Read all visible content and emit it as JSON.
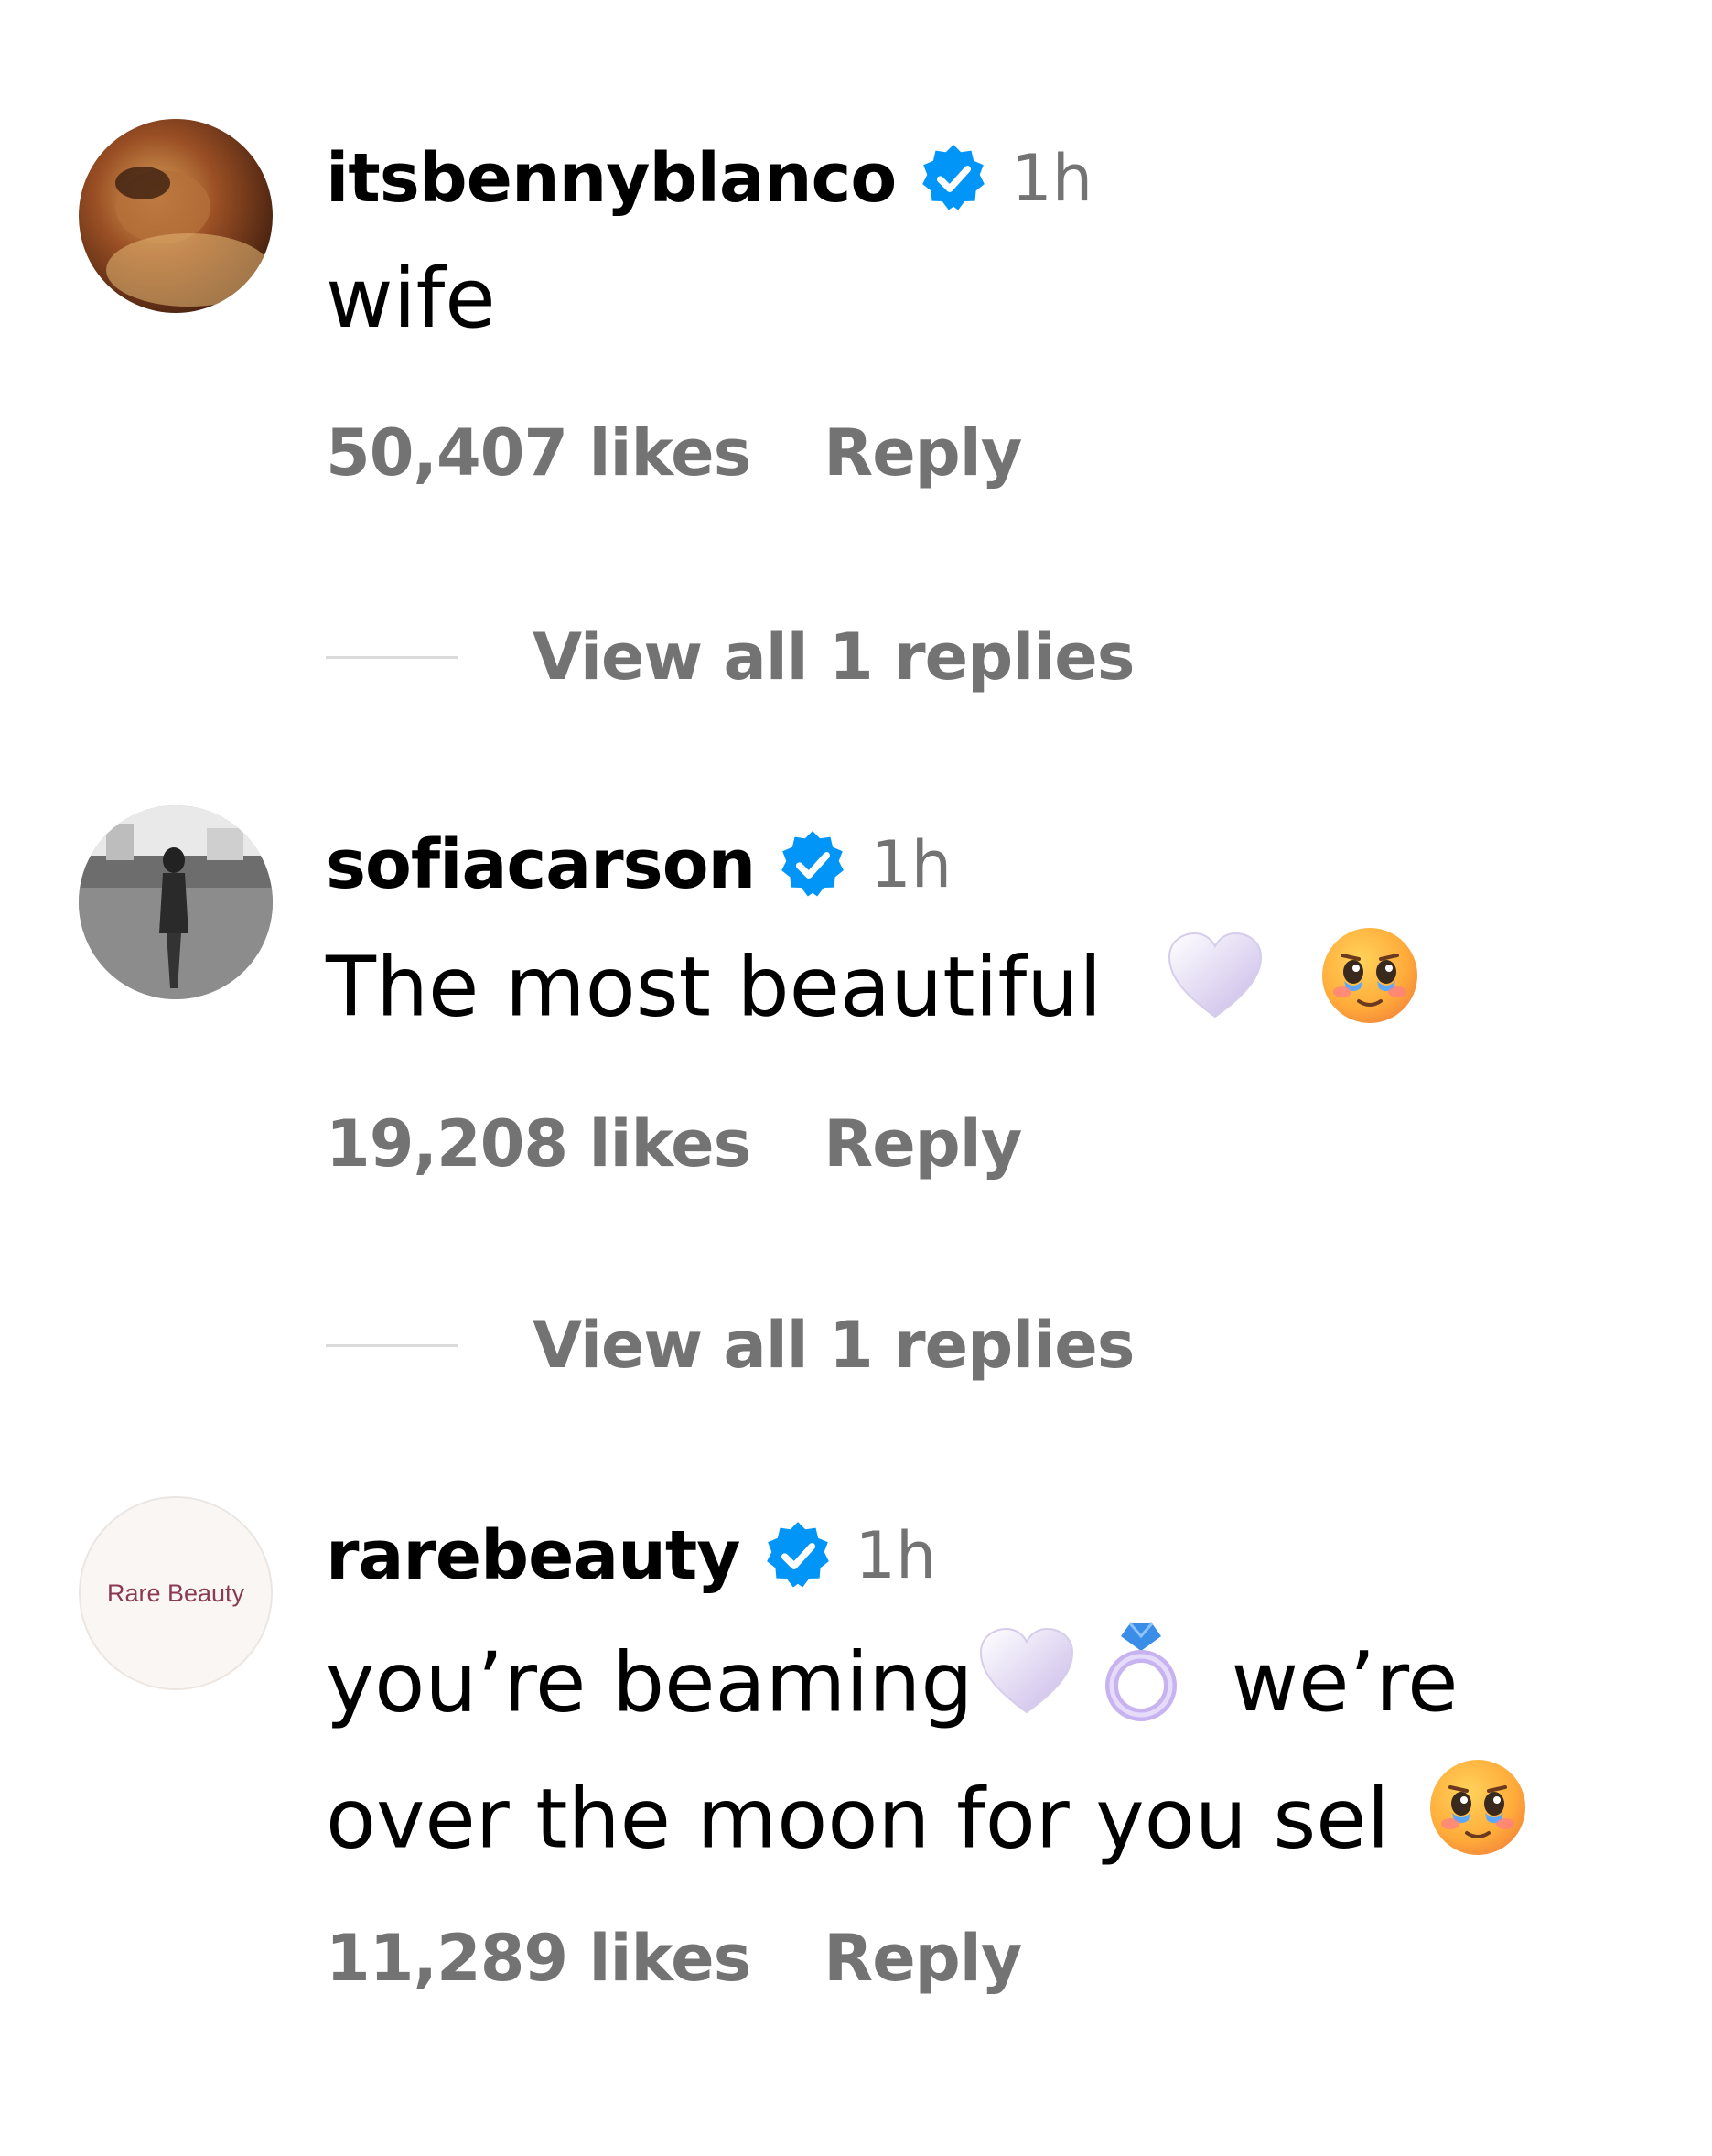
{
  "comments": [
    {
      "username": "itsbennyblanco",
      "time": "1h",
      "text": "wife",
      "likes": "50,407 likes",
      "reply_label": "Reply",
      "view_replies": "View all 1 replies"
    },
    {
      "username": "sofiacarson",
      "time": "1h",
      "text": "The most beautiful",
      "likes": "19,208 likes",
      "reply_label": "Reply",
      "view_replies": "View all 1 replies"
    },
    {
      "username": "rarebeauty",
      "avatar_label": "Rare Beauty",
      "time": "1h",
      "text_line1": "you’re beaming",
      "text_line1b": "we’re",
      "text_line2": "over the moon for you sel",
      "likes": "11,289 likes",
      "reply_label": "Reply"
    }
  ],
  "icons": {
    "verified": "verified-badge-icon",
    "heart": "white-heart-emoji",
    "face": "face-holding-back-tears-emoji",
    "ring": "ring-emoji"
  },
  "colors": {
    "verified_blue": "#0095f6",
    "secondary_text": "#737373",
    "divider": "#dbdbdb",
    "rare_beauty_brand": "#8a3a55"
  }
}
